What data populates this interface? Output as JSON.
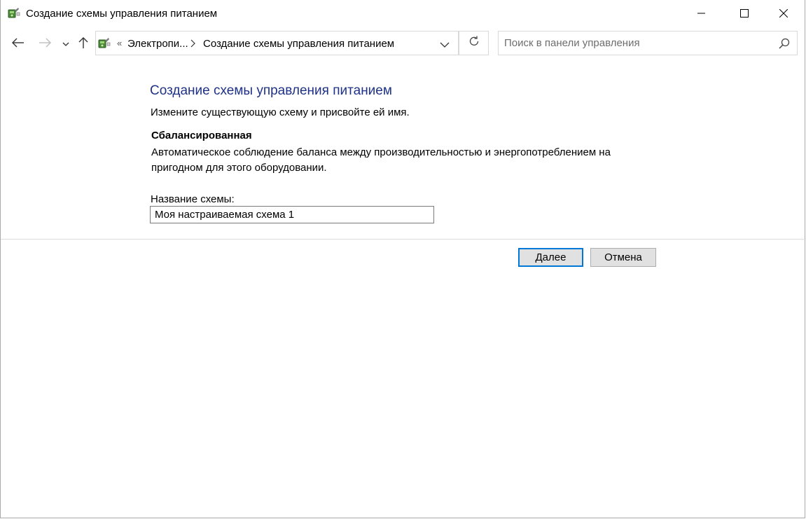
{
  "window": {
    "title": "Создание схемы управления питанием"
  },
  "navigation": {
    "breadcrumb_overflow": "«",
    "breadcrumb_1": "Электропи...",
    "breadcrumb_2": "Создание схемы управления питанием",
    "search_placeholder": "Поиск в панели управления"
  },
  "icons": {
    "app": "power-options-icon",
    "back": "arrow-left-icon",
    "forward": "arrow-right-icon",
    "recent": "chevron-down-icon",
    "up": "arrow-up-icon",
    "refresh": "refresh-icon",
    "search": "search-icon",
    "minimize": "minimize-icon",
    "maximize": "maximize-icon",
    "close": "close-icon"
  },
  "main": {
    "title": "Создание схемы управления питанием",
    "subtitle": "Измените существующую схему и присвойте ей имя.",
    "plan_name": "Сбалансированная",
    "plan_description": "Автоматическое соблюдение баланса между производительностью и энергопотреблением на пригодном для этого оборудовании.",
    "field_label": "Название схемы:",
    "field_value": "Моя настраиваемая схема 1",
    "next_label": "Далее",
    "cancel_label": "Отмена"
  },
  "colors": {
    "title_blue": "#1e3287",
    "focus_border": "#0078d7",
    "button_bg": "#e1e1e1"
  }
}
